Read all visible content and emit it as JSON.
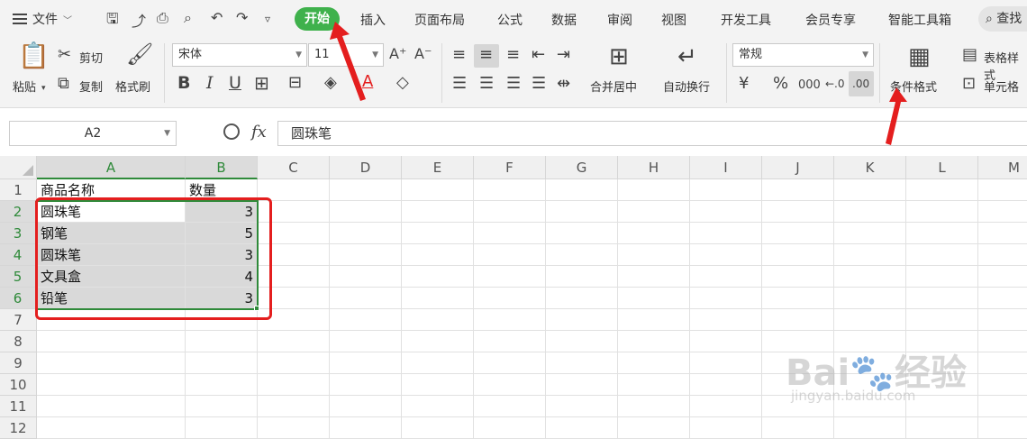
{
  "menubar": {
    "file_label": "文件",
    "tabs": [
      "开始",
      "插入",
      "页面布局",
      "公式",
      "数据",
      "审阅",
      "视图",
      "开发工具",
      "会员专享",
      "智能工具箱"
    ],
    "active_tab": "开始",
    "search_label": "查找"
  },
  "ribbon": {
    "paste_label": "粘贴",
    "cut_label": "剪切",
    "copy_label": "复制",
    "format_painter_label": "格式刷",
    "font_name": "宋体",
    "font_size": "11",
    "merge_center_label": "合并居中",
    "wrap_text_label": "自动换行",
    "number_format": "常规",
    "currency_symbol": "¥",
    "percent_symbol": "%",
    "thousands_symbol": "000",
    "conditional_format_label": "条件格式",
    "table_style_label": "表格样式",
    "cell_label": "单元格"
  },
  "formula_bar": {
    "name_box": "A2",
    "fx_label": "fx",
    "content": "圆珠笔"
  },
  "sheet": {
    "columns": [
      "A",
      "B",
      "C",
      "D",
      "E",
      "F",
      "G",
      "H",
      "I",
      "J",
      "K",
      "L",
      "M"
    ],
    "rows": [
      "1",
      "2",
      "3",
      "4",
      "5",
      "6",
      "7",
      "8",
      "9",
      "10",
      "11",
      "12"
    ],
    "data": [
      [
        "商品名称",
        "数量"
      ],
      [
        "圆珠笔",
        "3"
      ],
      [
        "钢笔",
        "5"
      ],
      [
        "圆珠笔",
        "3"
      ],
      [
        "文具盒",
        "4"
      ],
      [
        "铅笔",
        "3"
      ]
    ]
  },
  "watermark": {
    "brand": "Bai",
    "brand_suffix": "经验",
    "url": "jingyan.baidu.com"
  },
  "colors": {
    "active_tab_bg": "#3fb14c",
    "selection_green": "#2f8a3a",
    "annotation_red": "#e41e1e"
  }
}
